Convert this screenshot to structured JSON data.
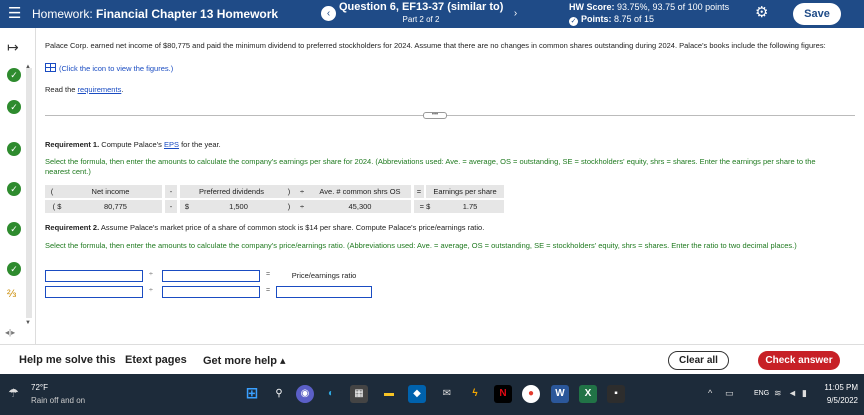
{
  "header": {
    "menu_icon": "hamburger-icon",
    "title_prefix": "Homework:",
    "title": "Financial Chapter 13 Homework",
    "question_title": "Question 6, EF13-37 (similar to)",
    "question_part": "Part 2 of 2",
    "score_label": "HW Score:",
    "score_value": "93.75%, 93.75 of 100 points",
    "points_label": "Points:",
    "points_value": "8.75 of 15",
    "save_label": "Save"
  },
  "problem": {
    "intro": "Palace Corp. earned net income of $80,775 and paid the minimum dividend to preferred stockholders for 2024. Assume that there are no changes in common shares outstanding during 2024. Palace's books include the following figures:",
    "figures_link": "(Click the icon to view the figures.)",
    "read_prefix": "Read the",
    "requirements_link": "requirements",
    "requirements_suffix": "."
  },
  "req1": {
    "title_bold": "Requirement 1.",
    "title_rest": " Compute Palace's ",
    "eps_link": "EPS",
    "title_end": " for the year.",
    "instruction": "Select the formula, then enter the amounts to calculate the company's earnings per share for 2024. (Abbreviations used: Ave. = average, OS = outstanding, SE = stockholders' equity, shrs = shares. Enter the earnings per share to the nearest cent.)",
    "headers": [
      "(",
      "Net income",
      "-",
      "Preferred dividends",
      ")",
      "÷",
      "Ave. # common shrs OS",
      "=",
      "Earnings per share"
    ],
    "values": [
      "( $",
      "80,775",
      "-",
      "$",
      "1,500",
      ")",
      "÷",
      "45,300",
      "= $",
      "1.75"
    ]
  },
  "req2": {
    "title_bold": "Requirement 2.",
    "title_rest": " Assume Palace's market price of a share of common stock is $14 per share. Compute Palace's price/earnings ratio.",
    "instruction": "Select the formula, then enter the amounts to calculate the company's price/earnings ratio. (Abbreviations used: Ave. = average, OS = outstanding, SE = stockholders' equity, shrs = shares. Enter the ratio to two decimal places.)",
    "op_divide": "÷",
    "op_equals": "=",
    "result_label": "Price/earnings ratio"
  },
  "toolbar": {
    "help_label": "Help me solve this",
    "etext_label": "Etext pages",
    "more_help_label": "Get more help ▴",
    "clear_label": "Clear all",
    "check_label": "Check answer"
  },
  "taskbar": {
    "weather_temp": "72°F",
    "weather_desc": "Rain off and on",
    "lang": "ENG",
    "time": "11:05 PM",
    "date": "9/5/2022"
  },
  "colors": {
    "header_bg": "#1f4b87",
    "check_answer": "#c72026",
    "correct_green": "#2e8b2e",
    "instruction_green": "#1f7a1f",
    "taskbar_bg": "#1d2b3a"
  }
}
